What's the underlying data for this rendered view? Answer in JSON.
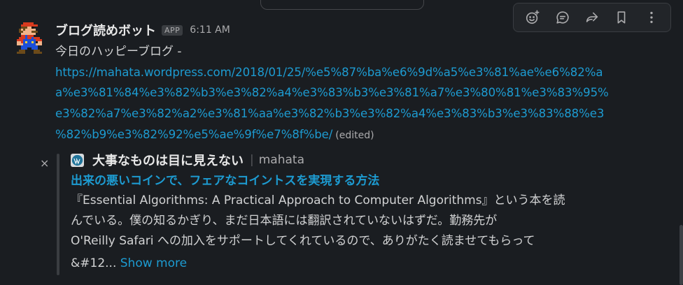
{
  "message": {
    "bot_name": "ブログ読めボット",
    "app_badge": "APP",
    "time": "6:11 AM",
    "text": "今日のハッピーブログ -",
    "link_lines": [
      "https://mahata.wordpress.com/2018/01/25/%e5%87%ba%e6%9d%a5%e3%81%ae%e6%82%a",
      "a%e3%81%84%e3%82%b3%e3%82%a4%e3%83%b3%e3%81%a7%e3%80%81%e3%83%95%",
      "e3%82%a7%e3%82%a2%e3%81%aa%e3%82%b3%e3%82%a4%e3%83%b3%e3%83%88%e3",
      "%82%b9%e3%82%92%e5%ae%9f%e7%8f%be/"
    ],
    "edited": "(edited)"
  },
  "attachment": {
    "site_title": "大事なものは目に見えない",
    "separator": "|",
    "author": "mahata",
    "title": "出来の悪いコインで、フェアなコイントスを実現する方法",
    "body_lines": [
      "『Essential Algorithms: A Practical Approach to Computer Algorithms』という本を読",
      "んでいる。僕の知るかぎり、まだ日本語には翻訳されていないはずだ。勤務先が",
      "O'Reilly Safari への加入をサポートしてくれているので、ありがたく読ませてもらって",
      "&#12..."
    ],
    "show_more": "Show more",
    "close": "×"
  },
  "toolbar": {
    "icons": [
      "add-reaction-icon",
      "reply-in-thread-icon",
      "share-icon",
      "bookmark-icon",
      "more-actions-icon"
    ]
  },
  "colors": {
    "background": "#1a1d21",
    "link": "#1d9bd1",
    "text": "#d1d2d3",
    "muted": "#ababad"
  }
}
